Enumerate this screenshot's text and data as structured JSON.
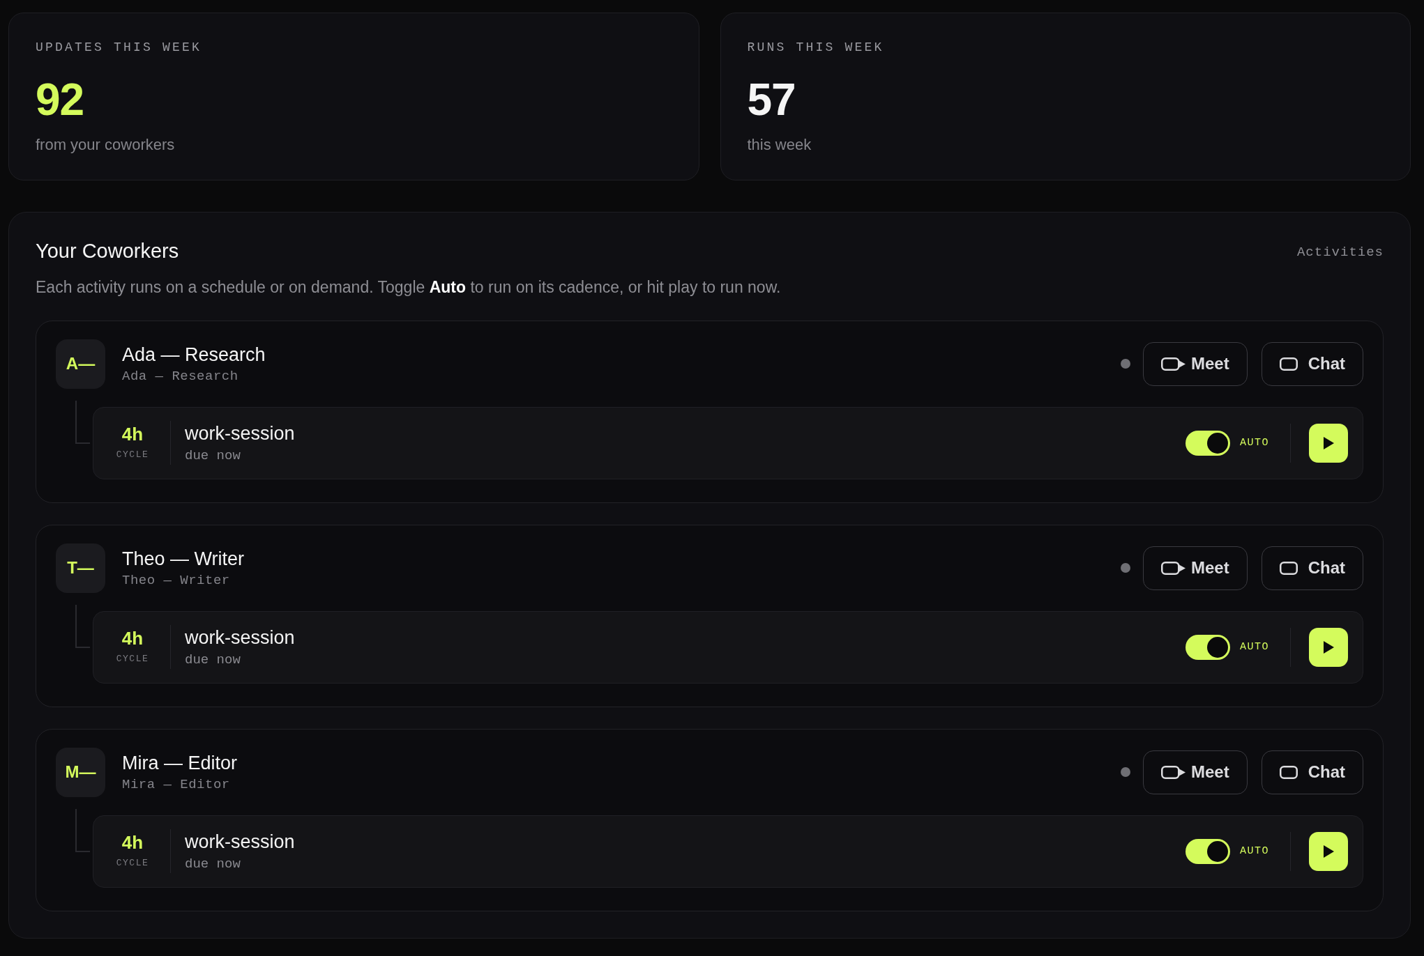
{
  "stats": [
    {
      "label": "UPDATES THIS WEEK",
      "value": "92",
      "caption": "from your coworkers",
      "accent": true
    },
    {
      "label": "RUNS THIS WEEK",
      "value": "57",
      "caption": "this week",
      "accent": false
    }
  ],
  "coworkers_panel": {
    "title": "Your Coworkers",
    "section_label": "Activities",
    "description": "Each activity runs on a schedule or on demand. Toggle **Auto** to run on its cadence, or hit play to run now.",
    "coworkers": [
      {
        "initials": "A—",
        "name": "Ada — Research",
        "subtitle": "Ada — Research",
        "online": false,
        "actions": [
          {
            "kind": "meet",
            "label": "Meet"
          },
          {
            "kind": "chat",
            "label": "Chat"
          }
        ],
        "activities": [
          {
            "cycle": "4h",
            "cycle_label": "CYCLE",
            "name": "work-session",
            "due": "due now",
            "auto": true,
            "auto_label": "AUTO"
          }
        ]
      },
      {
        "initials": "T—",
        "name": "Theo — Writer",
        "subtitle": "Theo — Writer",
        "online": false,
        "actions": [
          {
            "kind": "meet",
            "label": "Meet"
          },
          {
            "kind": "chat",
            "label": "Chat"
          }
        ],
        "activities": [
          {
            "cycle": "4h",
            "cycle_label": "CYCLE",
            "name": "work-session",
            "due": "due now",
            "auto": true,
            "auto_label": "AUTO"
          }
        ]
      },
      {
        "initials": "M—",
        "name": "Mira — Editor",
        "subtitle": "Mira — Editor",
        "online": false,
        "actions": [
          {
            "kind": "meet",
            "label": "Meet"
          },
          {
            "kind": "chat",
            "label": "Chat"
          }
        ],
        "activities": [
          {
            "cycle": "4h",
            "cycle_label": "CYCLE",
            "name": "work-session",
            "due": "due now",
            "auto": true,
            "auto_label": "AUTO"
          }
        ]
      }
    ]
  }
}
